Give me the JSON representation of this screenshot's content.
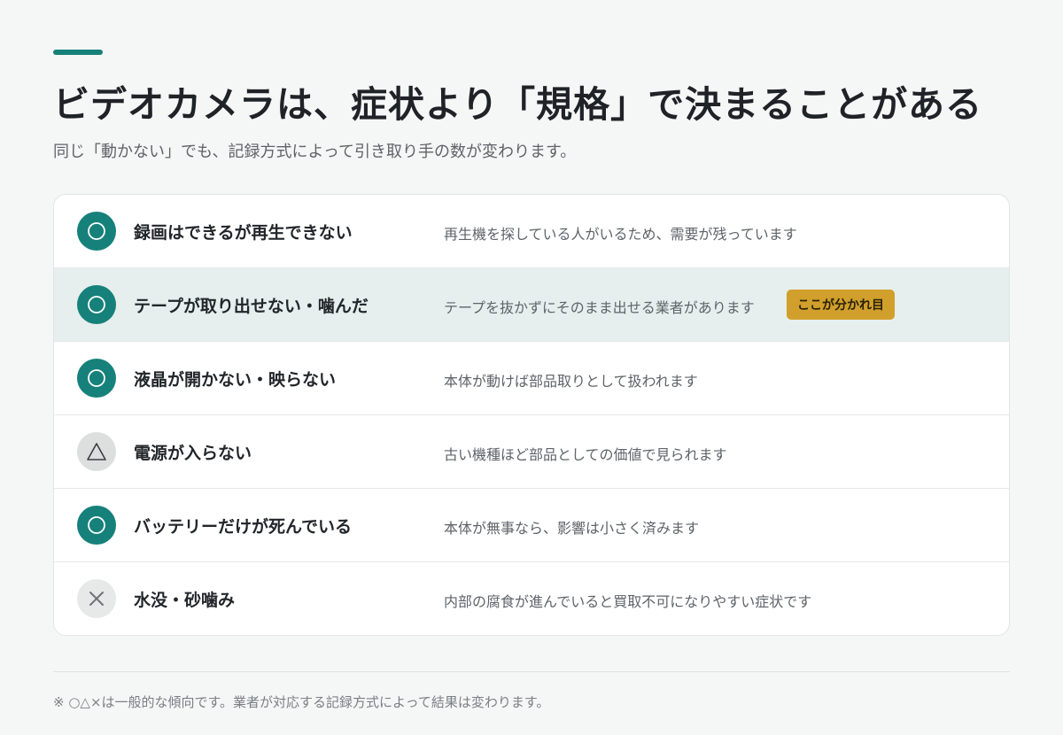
{
  "colors": {
    "accent": "#16817a",
    "badge": "#d19f2b",
    "highlight_row": "#e6efed"
  },
  "header": {
    "title": "ビデオカメラは、症状より「規格」で決まることがある",
    "subtitle": "同じ「動かない」でも、記録方式によって引き取り手の数が変わります。"
  },
  "rows": [
    {
      "rating": "good",
      "icon": "circle-icon",
      "symptom": "録画はできるが再生できない",
      "description": "再生機を探している人がいるため、需要が残っています"
    },
    {
      "rating": "good",
      "icon": "circle-icon",
      "symptom": "テープが取り出せない・噛んだ",
      "description": "テープを抜かずにそのまま出せる業者があります",
      "badge": "ここが分かれ目",
      "highlighted": true
    },
    {
      "rating": "good",
      "icon": "circle-icon",
      "symptom": "液晶が開かない・映らない",
      "description": "本体が動けば部品取りとして扱われます"
    },
    {
      "rating": "fair",
      "icon": "triangle-icon",
      "symptom": "電源が入らない",
      "description": "古い機種ほど部品としての価値で見られます"
    },
    {
      "rating": "good",
      "icon": "circle-icon",
      "symptom": "バッテリーだけが死んでいる",
      "description": "本体が無事なら、影響は小さく済みます"
    },
    {
      "rating": "bad",
      "icon": "cross-icon",
      "symptom": "水没・砂噛み",
      "description": "内部の腐食が進んでいると買取不可になりやすい症状です"
    }
  ],
  "footer": {
    "note": "※ ○△×は一般的な傾向です。業者が対応する記録方式によって結果は変わります。"
  }
}
